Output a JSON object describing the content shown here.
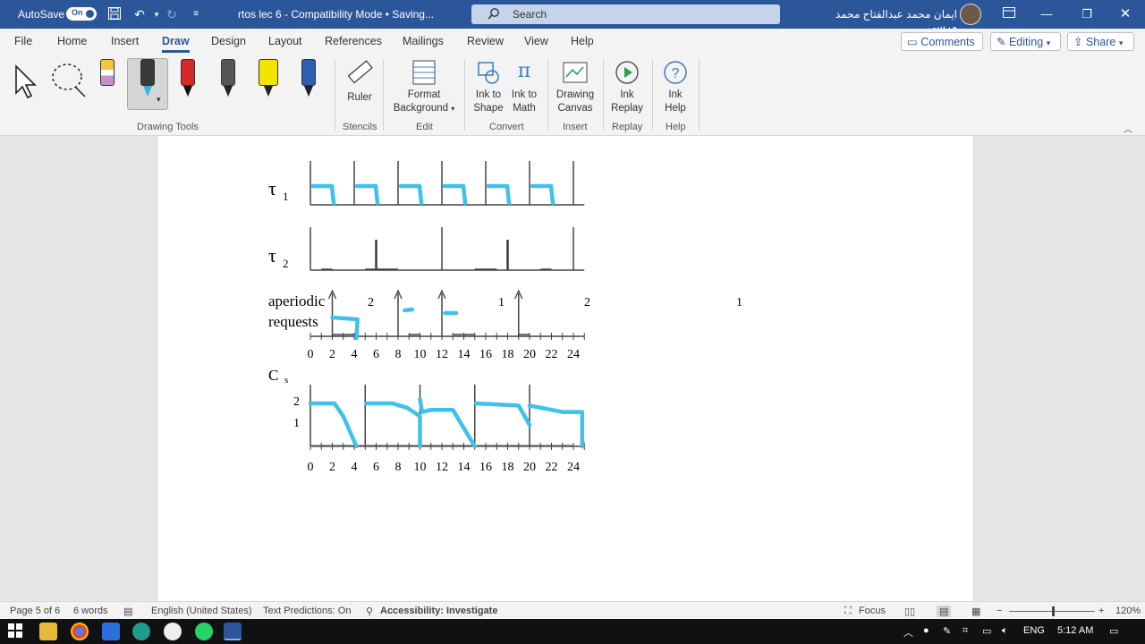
{
  "titlebar": {
    "autosave_label": "AutoSave",
    "autosave_state": "On",
    "document_title": "rtos lec 6  -  Compatibility Mode  •  Saving...",
    "search_placeholder": "Search",
    "user_name": "ايمان محمد عبدالفتاح محمد مرسى"
  },
  "tabs": [
    "File",
    "Home",
    "Insert",
    "Draw",
    "Design",
    "Layout",
    "References",
    "Mailings",
    "Review",
    "View",
    "Help"
  ],
  "active_tab": "Draw",
  "ribbon_buttons": {
    "comments": "Comments",
    "editing": "Editing",
    "share": "Share"
  },
  "ribbon": {
    "drawing_tools_label": "Drawing Tools",
    "ruler": "Ruler",
    "stencils_label": "Stencils",
    "format_bg_1": "Format",
    "format_bg_2": "Background",
    "edit_label": "Edit",
    "ink_shape_1": "Ink to",
    "ink_shape_2": "Shape",
    "ink_math_1": "Ink to",
    "ink_math_2": "Math",
    "convert_label": "Convert",
    "canvas_1": "Drawing",
    "canvas_2": "Canvas",
    "insert_label": "Insert",
    "replay_1": "Ink",
    "replay_2": "Replay",
    "replay_label": "Replay",
    "help_1": "Ink",
    "help_2": "Help",
    "help_label": "Help"
  },
  "pen_colors": [
    "#f5c542",
    "#4a4a4a",
    "#d62828",
    "#555555",
    "#f5e400",
    "#2f5fb3"
  ],
  "diagram": {
    "tau1": "τ",
    "tau1_sub": "1",
    "tau2": "τ",
    "tau2_sub": "2",
    "aperiodic_1": "aperiodic",
    "aperiodic_2": "requests",
    "req_labels": [
      "2",
      "1",
      "2",
      "1"
    ],
    "cs": "C",
    "cs_sub": "s",
    "cs_ticks": [
      "2",
      "1"
    ],
    "axis_ticks": [
      "0",
      "2",
      "4",
      "6",
      "8",
      "10",
      "12",
      "14",
      "16",
      "18",
      "20",
      "22",
      "24"
    ],
    "ink_color": "#3ec1ea"
  },
  "status": {
    "page": "Page 5 of 6",
    "words": "6 words",
    "language": "English (United States)",
    "predictions": "Text Predictions: On",
    "accessibility": "Accessibility: Investigate",
    "focus": "Focus",
    "zoom": "120%"
  },
  "taskbar": {
    "lang": "ENG",
    "time": "5:12 AM"
  }
}
